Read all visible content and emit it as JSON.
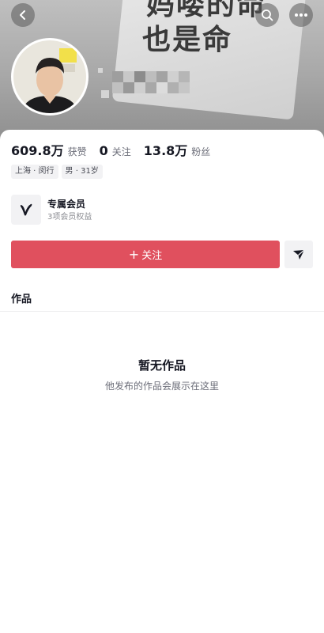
{
  "banner": {
    "line1": "妈喽的命",
    "line2": "也是命"
  },
  "header": {
    "back_icon": "chevron-left-icon",
    "search_icon": "search-icon",
    "more_icon": "more-dots-icon"
  },
  "profile": {
    "stats": [
      {
        "value": "609.8万",
        "label": "获赞"
      },
      {
        "value": "0",
        "label": "关注"
      },
      {
        "value": "13.8万",
        "label": "粉丝"
      }
    ],
    "tags": [
      "上海 · 闵行",
      "男 · 31岁"
    ]
  },
  "member": {
    "title": "专属会员",
    "subtitle": "3项会员权益"
  },
  "actions": {
    "follow_plus": "+",
    "follow_label": "关注"
  },
  "tabs": {
    "works": "作品"
  },
  "empty": {
    "title": "暂无作品",
    "subtitle": "他发布的作品会展示在这里"
  },
  "colors": {
    "follow": "#e0505e",
    "text_primary": "#161823",
    "text_secondary": "#6b6d78"
  }
}
